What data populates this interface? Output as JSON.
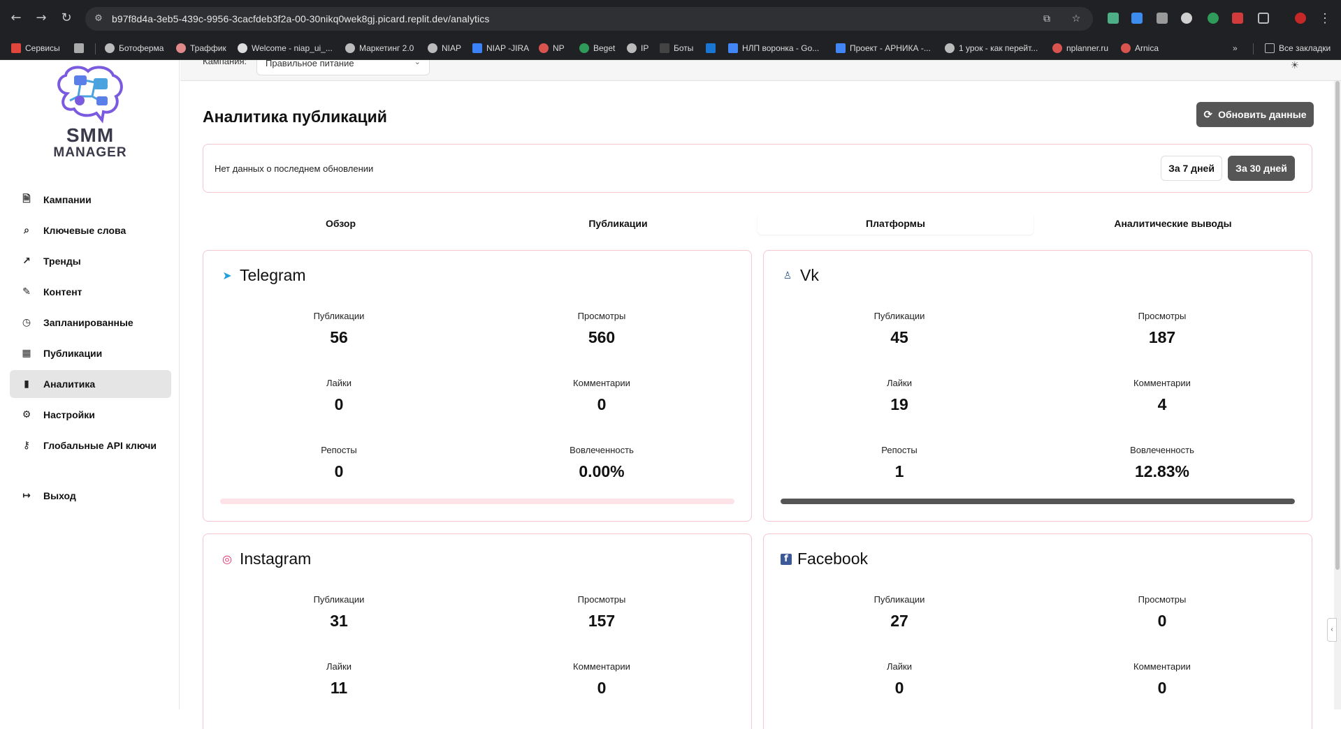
{
  "browser": {
    "url": "b97f8d4a-3eb5-439c-9956-3cacfdeb3f2a-00-30nikq0wek8gj.picard.replit.dev/analytics",
    "bookmarks": [
      "Сервисы",
      "Ботоферма",
      "Траффик",
      "Welcome - niap_ui_...",
      "Маркетинг 2.0",
      "NIAP",
      "NIAP -JIRA",
      "NP",
      "Beget",
      "IP",
      "Боты",
      "НЛП воронка - Go...",
      "Проект - АРНИКА -...",
      "1 урок - как перейт...",
      "nplanner.ru",
      "Arnica"
    ],
    "all_bookmarks": "Все закладки"
  },
  "logo": {
    "line1": "SMM",
    "line2": "MANAGER"
  },
  "sidebar": {
    "items": [
      {
        "label": "Кампании",
        "icon": "document-icon"
      },
      {
        "label": "Ключевые слова",
        "icon": "search-icon"
      },
      {
        "label": "Тренды",
        "icon": "trend-icon"
      },
      {
        "label": "Контент",
        "icon": "pen-icon"
      },
      {
        "label": "Запланированные",
        "icon": "clock-icon"
      },
      {
        "label": "Публикации",
        "icon": "calendar-icon"
      },
      {
        "label": "Аналитика",
        "icon": "bar-chart-icon"
      },
      {
        "label": "Настройки",
        "icon": "gear-icon"
      },
      {
        "label": "Глобальные API ключи",
        "icon": "key-icon"
      }
    ],
    "logout": "Выход"
  },
  "topbar": {
    "label": "Кампания:",
    "selected": "Правильное питание"
  },
  "page": {
    "title": "Аналитика публикаций",
    "refresh_label": "Обновить данные",
    "info_text": "Нет данных о последнем обновлении",
    "period_7": "За 7 дней",
    "period_30": "За 30 дней"
  },
  "tabs": [
    "Обзор",
    "Публикации",
    "Платформы",
    "Аналитические выводы"
  ],
  "labels": {
    "publications": "Публикации",
    "views": "Просмотры",
    "likes": "Лайки",
    "comments": "Комментарии",
    "reposts": "Репосты",
    "engagement": "Вовлеченность"
  },
  "platforms": [
    {
      "name": "Telegram",
      "icon": "telegram-icon",
      "publications": "56",
      "views": "560",
      "likes": "0",
      "comments": "0",
      "reposts": "0",
      "engagement": "0.00%",
      "engagement_fraction": 0.0
    },
    {
      "name": "Vk",
      "icon": "vk-icon",
      "publications": "45",
      "views": "187",
      "likes": "19",
      "comments": "4",
      "reposts": "1",
      "engagement": "12.83%",
      "engagement_fraction": 1.0
    },
    {
      "name": "Instagram",
      "icon": "instagram-icon",
      "publications": "31",
      "views": "157",
      "likes": "11",
      "comments": "0"
    },
    {
      "name": "Facebook",
      "icon": "facebook-icon",
      "publications": "27",
      "views": "0",
      "likes": "0",
      "comments": "0"
    }
  ],
  "colors": {
    "accent": "#565656",
    "card_border": "#f7c6cf",
    "progress_track": "#fde2e8"
  }
}
